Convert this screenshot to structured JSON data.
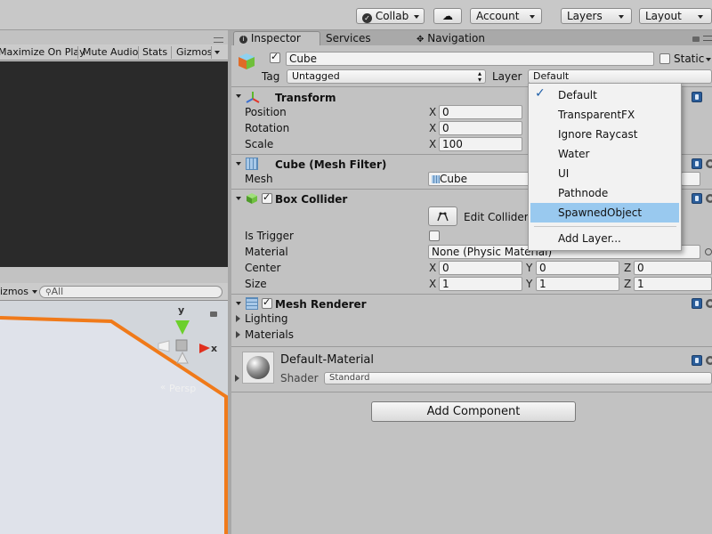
{
  "toolbar": {
    "collab_label": "Collab",
    "account_label": "Account",
    "layers_label": "Layers",
    "layout_label": "Layout"
  },
  "game_view": {
    "maximize_on_play": "Maximize On Play",
    "mute_audio": "Mute Audio",
    "stats": "Stats",
    "gizmos": "Gizmos"
  },
  "scene_view": {
    "gizmos": "izmos",
    "search_placeholder": "All",
    "gizmo_y": "y",
    "gizmo_x": "x",
    "persp": "Persp"
  },
  "tabs": {
    "inspector": "Inspector",
    "services": "Services",
    "navigation": "Navigation"
  },
  "object": {
    "name": "Cube",
    "static_label": "Static",
    "tag_label": "Tag",
    "tag_value": "Untagged",
    "layer_label": "Layer",
    "layer_value": "Default"
  },
  "transform": {
    "title": "Transform",
    "position_label": "Position",
    "rotation_label": "Rotation",
    "scale_label": "Scale",
    "x_axis": "X",
    "position_x": "0",
    "rotation_x": "0",
    "scale_x": "100"
  },
  "mesh_filter": {
    "title": "Cube (Mesh Filter)",
    "mesh_label": "Mesh",
    "mesh_value": "Cube"
  },
  "box_collider": {
    "title": "Box Collider",
    "edit_collider": "Edit Collider",
    "is_trigger_label": "Is Trigger",
    "material_label": "Material",
    "material_value": "None (Physic Material)",
    "center_label": "Center",
    "size_label": "Size",
    "x_axis": "X",
    "y_axis": "Y",
    "z_axis": "Z",
    "center_x": "0",
    "center_y": "0",
    "center_z": "0",
    "size_x": "1",
    "size_y": "1",
    "size_z": "1"
  },
  "mesh_renderer": {
    "title": "Mesh Renderer",
    "lighting": "Lighting",
    "materials": "Materials"
  },
  "material": {
    "name": "Default-Material",
    "shader_label": "Shader",
    "shader_value": "Standard"
  },
  "add_component": "Add Component",
  "layer_menu": {
    "items": [
      "Default",
      "TransparentFX",
      "Ignore Raycast",
      "Water",
      "UI",
      "Pathnode",
      "SpawnedObject"
    ],
    "add_layer": "Add Layer...",
    "selected": "Default",
    "highlighted": "SpawnedObject"
  },
  "colors": {
    "selection_blue": "#99c9ef",
    "scene_orange": "#f07a1a",
    "game_dark": "#2a2a2a"
  }
}
